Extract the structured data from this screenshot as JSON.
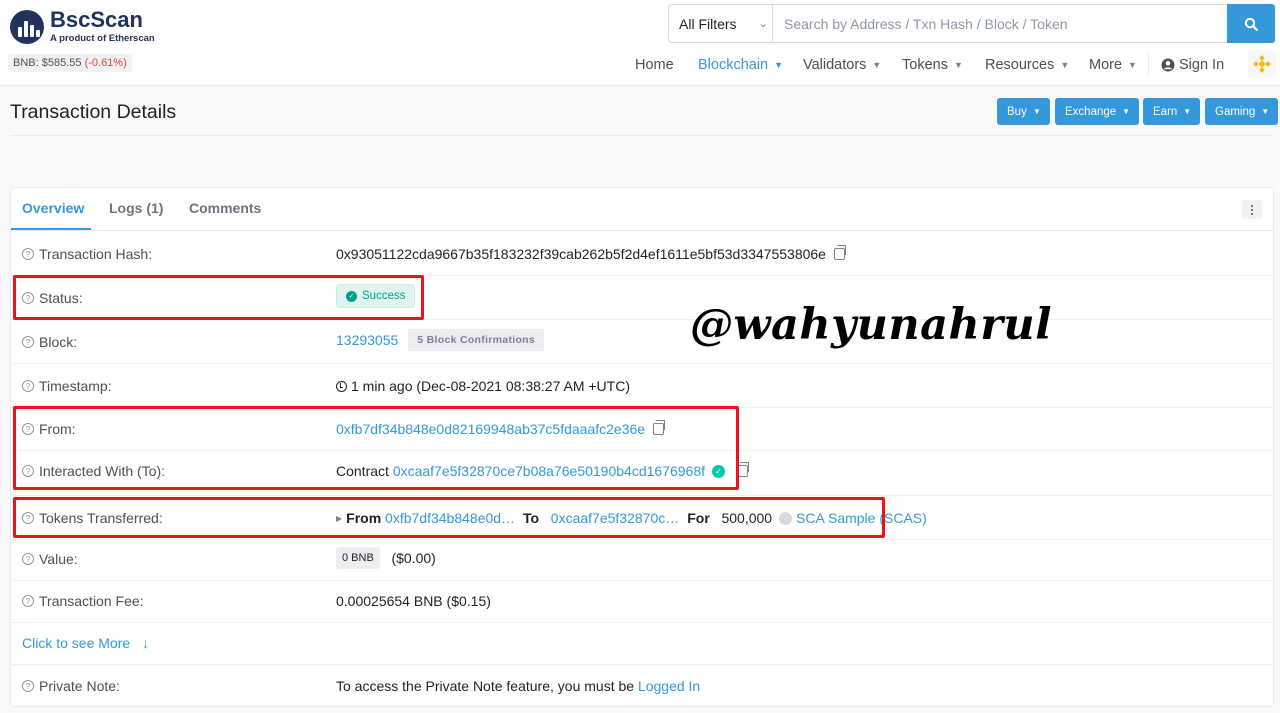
{
  "brand": {
    "name": "BscScan",
    "tagline": "A product of Etherscan"
  },
  "price": {
    "label": "BNB: $585.55",
    "change": "(-0.61%)"
  },
  "search": {
    "filter": "All Filters",
    "placeholder": "Search by Address / Txn Hash / Block / Token"
  },
  "nav": {
    "home": "Home",
    "blockchain": "Blockchain",
    "validators": "Validators",
    "tokens": "Tokens",
    "resources": "Resources",
    "more": "More",
    "signin": "Sign In"
  },
  "page": {
    "title": "Transaction Details"
  },
  "buttons": {
    "buy": "Buy",
    "exchange": "Exchange",
    "earn": "Earn",
    "gaming": "Gaming"
  },
  "tabs": {
    "overview": "Overview",
    "logs": "Logs (1)",
    "comments": "Comments"
  },
  "tx": {
    "hash_label": "Transaction Hash:",
    "hash": "0x93051122cda9667b35f183232f39cab262b5f2d4ef1611e5bf53d3347553806e",
    "status_label": "Status:",
    "status": "Success",
    "block_label": "Block:",
    "block": "13293055",
    "confirmations": "5 Block Confirmations",
    "timestamp_label": "Timestamp:",
    "timestamp": "1 min ago (Dec-08-2021 08:38:27 AM +UTC)",
    "from_label": "From:",
    "from": "0xfb7df34b848e0d82169948ab37c5fdaaafc2e36e",
    "to_label": "Interacted With (To):",
    "to_prefix": "Contract",
    "to": "0xcaaf7e5f32870ce7b08a76e50190b4cd1676968f",
    "tokens_label": "Tokens Transferred:",
    "tt_from_kw": "From",
    "tt_from": "0xfb7df34b848e0d…",
    "tt_to_kw": "To",
    "tt_to": "0xcaaf7e5f32870c…",
    "tt_for_kw": "For",
    "tt_amount": "500,000",
    "tt_token": "SCA Sample (SCAS)",
    "value_label": "Value:",
    "value": "0 BNB",
    "value_usd": "($0.00)",
    "fee_label": "Transaction Fee:",
    "fee": "0.00025654 BNB ($0.15)",
    "see_more": "Click to see More",
    "note_label": "Private Note:",
    "note_text": "To access the Private Note feature, you must be",
    "note_link": "Logged In"
  },
  "watermark": "@wahyunahrul",
  "colors": {
    "accent": "#3498db",
    "success": "#00a186",
    "highlight": "#e8141a"
  }
}
